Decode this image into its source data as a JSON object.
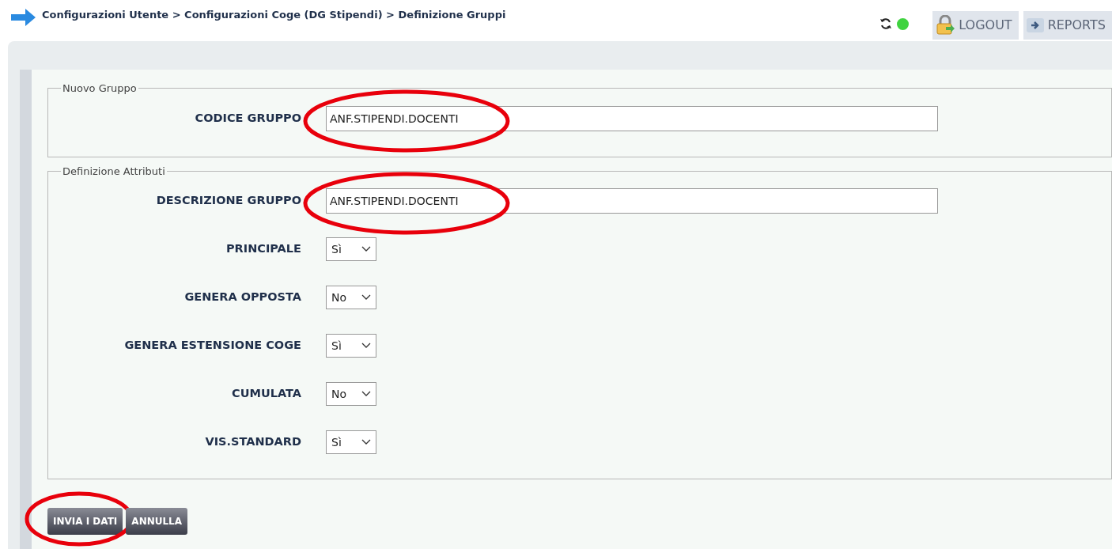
{
  "breadcrumb": "Configurazioni Utente > Configurazioni Coge (DG Stipendi) > Definizione Gruppi",
  "header_buttons": [
    {
      "label": "LOGOUT",
      "kind": "lock"
    },
    {
      "label": "REPORTS",
      "kind": "arrow"
    }
  ],
  "status": {
    "online": true
  },
  "fieldsets": [
    {
      "legend": "Nuovo Gruppo",
      "fields": [
        {
          "label": "CODICE GRUPPO",
          "kind": "text",
          "value": "ANF.STIPENDI.DOCENTI",
          "highlighted": true
        }
      ]
    },
    {
      "legend": "Definizione Attributi",
      "fields": [
        {
          "label": "DESCRIZIONE GRUPPO",
          "kind": "text",
          "value": "ANF.STIPENDI.DOCENTI",
          "highlighted": true
        },
        {
          "label": "PRINCIPALE",
          "kind": "select",
          "value": "Sì",
          "highlighted": false
        },
        {
          "label": "GENERA OPPOSTA",
          "kind": "select",
          "value": "No",
          "highlighted": false
        },
        {
          "label": "GENERA ESTENSIONE COGE",
          "kind": "select",
          "value": "Sì",
          "highlighted": false
        },
        {
          "label": "CUMULATA",
          "kind": "select",
          "value": "No",
          "highlighted": false
        },
        {
          "label": "VIS.STANDARD",
          "kind": "select",
          "value": "Sì",
          "highlighted": false
        }
      ]
    }
  ],
  "actions": [
    {
      "label": "INVIA I DATI",
      "highlighted": true
    },
    {
      "label": "ANNULLA",
      "highlighted": false
    }
  ]
}
